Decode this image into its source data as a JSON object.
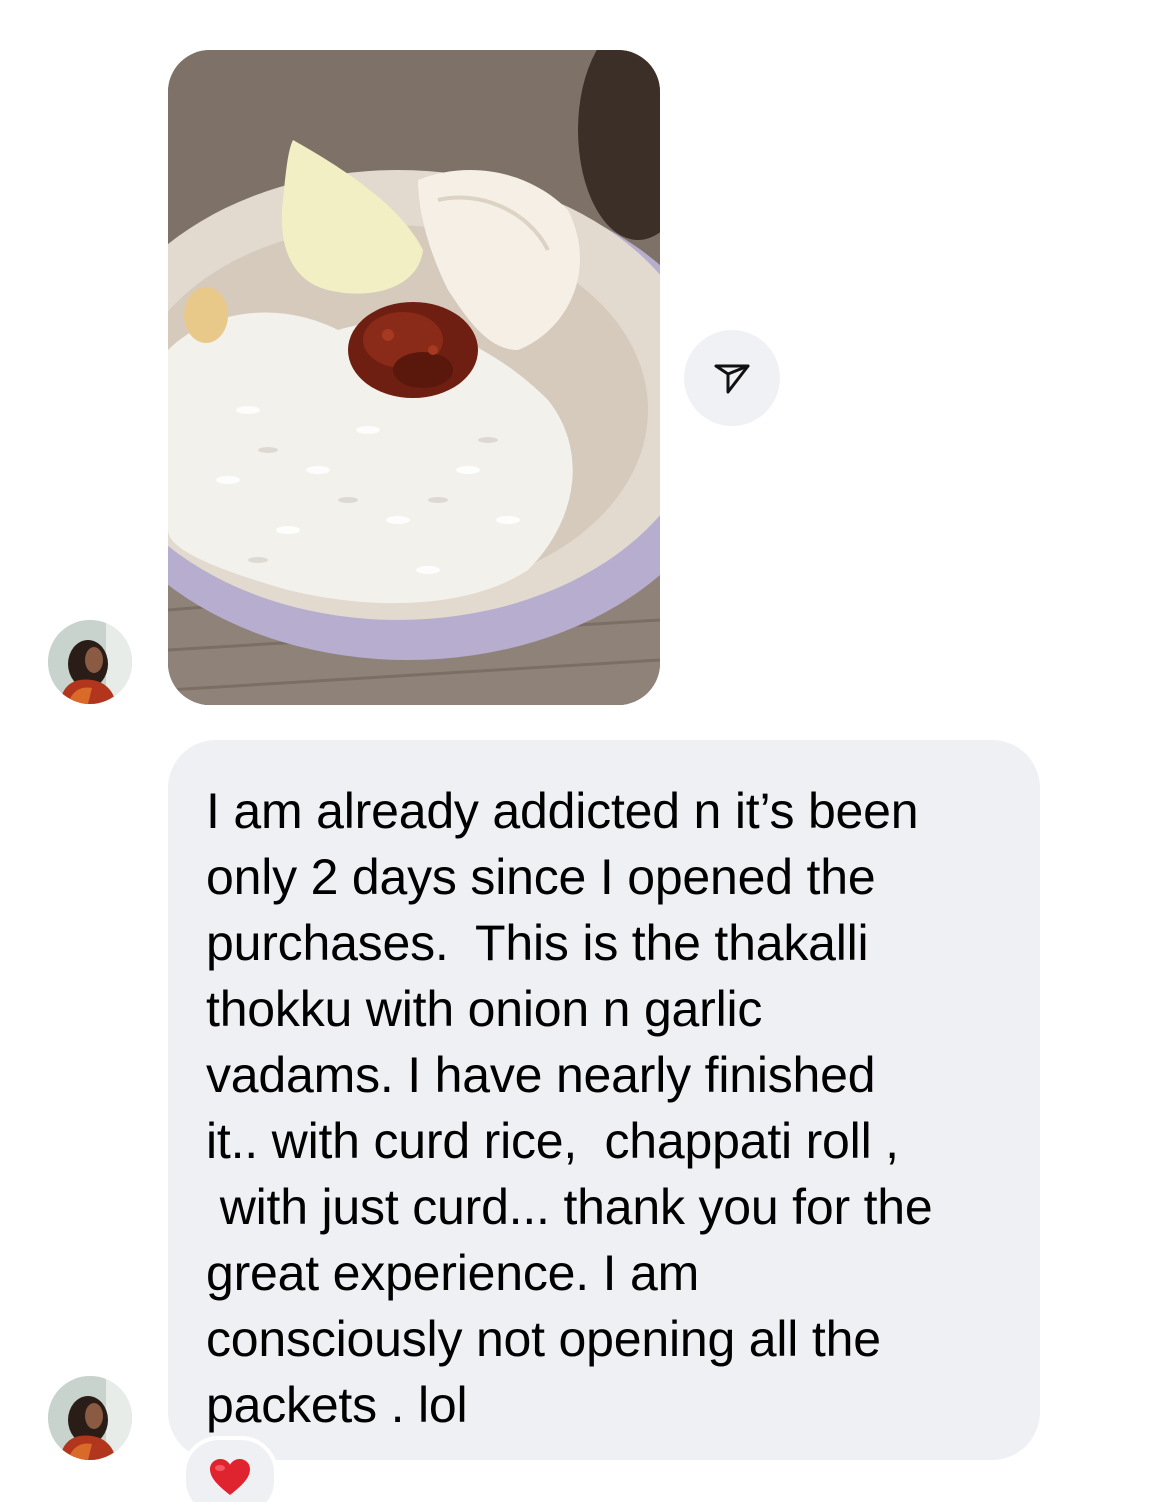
{
  "thread": {
    "image_message": {
      "image_alt": "Bowl of white rice with thakkali thokku and vadams"
    },
    "share_icon": "paper-plane-icon",
    "text_message": {
      "text": "I am already addicted n it’s been\nonly 2 days since I opened the\npurchases.  This is the thakalli\nthokku with onion n garlic\nvadams. I have nearly finished\nit.. with curd rice,  chappati roll ,\n with just curd... thank you for the\ngreat experience. I am\nconsciously not opening all the\npackets . lol"
    },
    "reaction": {
      "icon": "red-heart-icon",
      "color": "#e0242f"
    },
    "colors": {
      "bubble_background": "#eff0f3",
      "text": "#000000"
    }
  }
}
